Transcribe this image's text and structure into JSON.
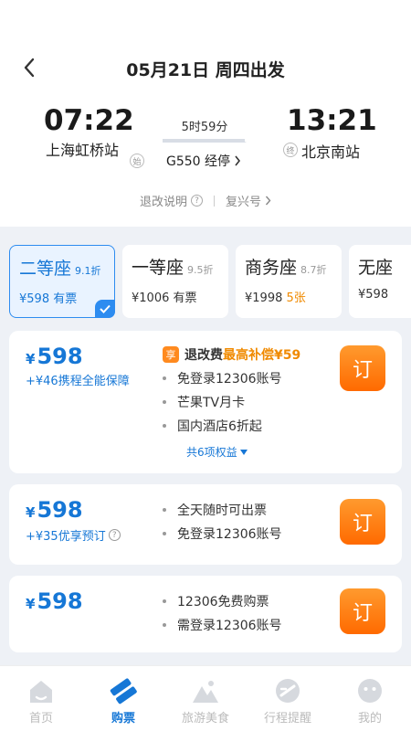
{
  "header": {
    "title": "05月21日 周四出发"
  },
  "journey": {
    "departure_time": "07:22",
    "departure_station": "上海虹桥站",
    "departure_badge": "始",
    "arrival_time": "13:21",
    "arrival_station": "北京南站",
    "arrival_badge": "终",
    "duration": "5时59分",
    "train_info": "G550 经停"
  },
  "links": {
    "refund_policy": "退改说明",
    "train_type": "复兴号"
  },
  "seats": [
    {
      "name": "二等座",
      "discount": "9.1折",
      "price": "¥598",
      "availability": "有票",
      "selected": true
    },
    {
      "name": "一等座",
      "discount": "9.5折",
      "price": "¥1006",
      "availability": "有票",
      "selected": false
    },
    {
      "name": "商务座",
      "discount": "8.7折",
      "price": "¥1998",
      "availability": "5张",
      "selected": false
    },
    {
      "name": "无座",
      "discount": "",
      "price": "¥598",
      "availability": "",
      "selected": false
    }
  ],
  "offers": [
    {
      "price": "598",
      "currency": "¥",
      "extra": "+¥46携程全能保障",
      "refund_badge": "享",
      "refund_label": "退改费",
      "refund_highlight": "最高补偿¥59",
      "features": [
        "免登录12306账号",
        "芒果TV月卡",
        "国内酒店6折起"
      ],
      "more": "共6项权益",
      "button": "订"
    },
    {
      "price": "598",
      "currency": "¥",
      "extra": "+¥35优享预订",
      "features": [
        "全天随时可出票",
        "免登录12306账号"
      ],
      "button": "订"
    },
    {
      "price": "598",
      "currency": "¥",
      "extra": "",
      "features": [
        "12306免费购票",
        "需登录12306账号"
      ],
      "button": "订"
    }
  ],
  "tabbar": [
    {
      "label": "首页",
      "icon": "home-icon",
      "active": false
    },
    {
      "label": "购票",
      "icon": "ticket-icon",
      "active": true
    },
    {
      "label": "旅游美食",
      "icon": "mountain-icon",
      "active": false
    },
    {
      "label": "行程提醒",
      "icon": "itinerary-icon",
      "active": false
    },
    {
      "label": "我的",
      "icon": "profile-icon",
      "active": false
    }
  ],
  "colors": {
    "accent": "#1677d6",
    "orange": "#ff7a10"
  }
}
